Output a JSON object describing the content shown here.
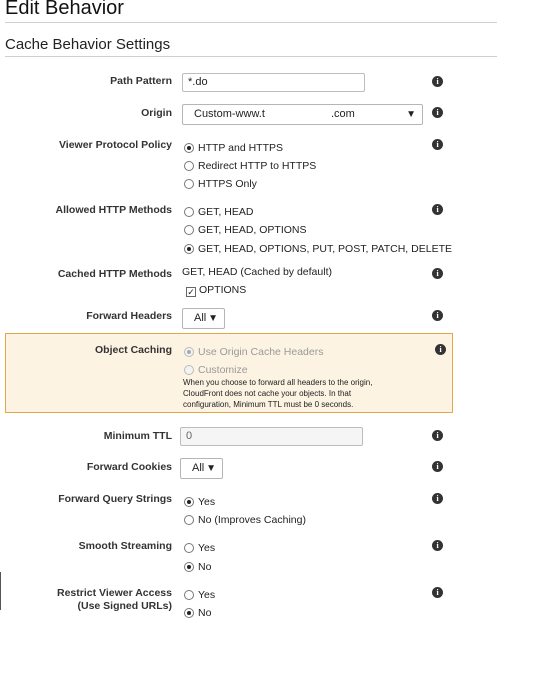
{
  "page": {
    "title": "Edit Behavior",
    "section_title": "Cache Behavior Settings"
  },
  "path_pattern": {
    "label": "Path Pattern",
    "value": "*.do"
  },
  "origin": {
    "label": "Origin",
    "value_prefix": "Custom-www.t",
    "value_suffix": ".com"
  },
  "viewer_protocol": {
    "label": "Viewer Protocol Policy",
    "options": [
      "HTTP and HTTPS",
      "Redirect HTTP to HTTPS",
      "HTTPS Only"
    ],
    "selected": 0
  },
  "allowed_methods": {
    "label": "Allowed HTTP Methods",
    "options": [
      "GET, HEAD",
      "GET, HEAD, OPTIONS",
      "GET, HEAD, OPTIONS, PUT, POST, PATCH, DELETE"
    ],
    "selected": 2
  },
  "cached_methods": {
    "label": "Cached HTTP Methods",
    "static_text": "GET, HEAD (Cached by default)",
    "options_label": "OPTIONS",
    "options_checked": true
  },
  "forward_headers": {
    "label": "Forward Headers",
    "value": "All"
  },
  "object_caching": {
    "label": "Object Caching",
    "options": [
      "Use Origin Cache Headers",
      "Customize"
    ],
    "selected": 0,
    "note": "When you choose to forward all headers to the origin, CloudFront does not cache your objects. In that configuration, Minimum TTL must be 0 seconds."
  },
  "minimum_ttl": {
    "label": "Minimum TTL",
    "value": "0"
  },
  "forward_cookies": {
    "label": "Forward Cookies",
    "value": "All"
  },
  "forward_query_strings": {
    "label": "Forward Query Strings",
    "options": [
      "Yes",
      "No (Improves Caching)"
    ],
    "selected": 0
  },
  "smooth_streaming": {
    "label": "Smooth Streaming",
    "options": [
      "Yes",
      "No"
    ],
    "selected": 1
  },
  "restrict_viewer_access": {
    "label_line1": "Restrict Viewer Access",
    "label_line2": "(Use Signed URLs)",
    "options": [
      "Yes",
      "No"
    ],
    "selected": 1
  },
  "icons": {
    "info": "info-icon",
    "dropdown": "chevron-down-icon",
    "radio": "radio-button",
    "checkbox": "checkbox"
  },
  "colors": {
    "caching_box_bg": "#fdf3e3",
    "caching_box_border": "#e3a64a"
  }
}
